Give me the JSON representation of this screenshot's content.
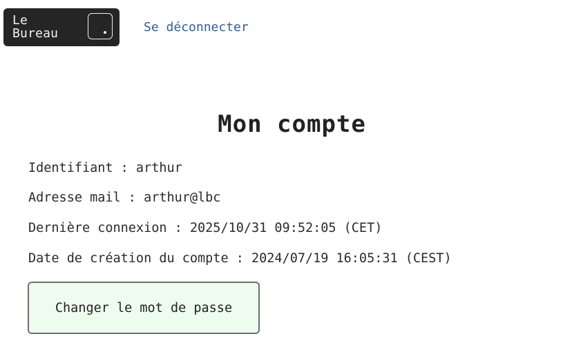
{
  "header": {
    "logo_line1": "Le",
    "logo_line2": "Bureau",
    "logout_label": "Se déconnecter"
  },
  "main": {
    "title": "Mon compte",
    "username_line": "Identifiant : arthur",
    "email_line": "Adresse mail : arthur@lbc",
    "last_login_line": "Dernière connexion : 2025/10/31 09:52:05 (CET)",
    "created_line": "Date de création du compte : 2024/07/19 16:05:31 (CEST)",
    "change_password_label": "Changer le mot de passe"
  },
  "colors": {
    "logo_bg": "#252525",
    "link": "#2f5f9a",
    "button_bg": "#eefcef",
    "button_border": "#6f6f6f"
  }
}
